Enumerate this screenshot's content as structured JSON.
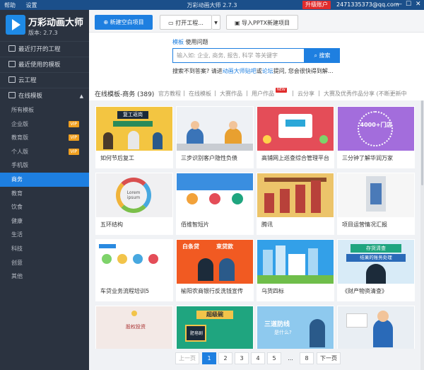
{
  "titlebar": {
    "help": "帮助",
    "settings": "设置",
    "title": "万彩动画大师 2.7.3",
    "upgrade": "升级账户",
    "account": "2471335373@qq.com",
    "min": "—",
    "max": "☐",
    "close": "✕"
  },
  "app": {
    "name": "万彩动画大师",
    "version": "版本: 2.7.3"
  },
  "sidebar": {
    "main": [
      {
        "label": "最近打开的工程"
      },
      {
        "label": "最近使用的模板"
      },
      {
        "label": "云工程"
      },
      {
        "label": "在线模板",
        "caret": "▲"
      }
    ],
    "sub": [
      {
        "label": "所有模板"
      },
      {
        "label": "企业版",
        "vip": "VIP"
      },
      {
        "label": "教育版",
        "vip": "VIP"
      },
      {
        "label": "个人版",
        "vip": "VIP"
      },
      {
        "label": "手机版"
      },
      {
        "label": "商务"
      },
      {
        "label": "教育"
      },
      {
        "label": "饮食"
      },
      {
        "label": "健康"
      },
      {
        "label": "生活"
      },
      {
        "label": "科技"
      },
      {
        "label": "创意"
      },
      {
        "label": "其他"
      }
    ]
  },
  "toolbar": {
    "new_project": "新建空白项目",
    "open_project": "打开工程...",
    "dropdown": "▼",
    "import_pptx": "导入PPTX新建项目"
  },
  "search": {
    "tab_template": "模板",
    "tab_help": "使用问题",
    "placeholder": "输入如: 企业, 商务, 报告, 科学 等关键字",
    "button": "搜索",
    "hint_prefix": "搜索不到答案? 请进",
    "hint_link1": "动画大师贴吧",
    "hint_or": "或",
    "hint_link2": "论坛",
    "hint_suffix": "提问, 您会很快得到解..."
  },
  "categories": {
    "current": "在线模板-商务 (389)",
    "tabs": [
      "官方教程",
      "在线模板",
      "大赛作品",
      "用户作品",
      "云分享",
      "大赛及优秀作品分享 (不断更新中"
    ],
    "new_badge": "NEW"
  },
  "templates": [
    "如何节后复工",
    "三步识别客户隐性负债",
    "高铺网上巡查综合管理平台",
    "三分钟了解华润万家",
    "五环结构",
    "佰维智短片",
    "腾讯",
    "项目运营情况汇报",
    "车贷业务流程培训5",
    "榆阳农商银行反洗钱宣传",
    "乌货四标",
    "《财产物资清查》",
    "",
    "",
    "",
    ""
  ],
  "thumb_text": {
    "t1": "复工返岗",
    "t4": "4000+门店",
    "t5": "Lorem ipsum",
    "t10": "白条贷",
    "t10b": "束贷款",
    "t12": "乌货四标",
    "t13": "股权投资",
    "t14": "超级碗",
    "t14b": "肥皂剧",
    "t15": "三道防线",
    "t15b": "是什么?",
    "t16": "存货清查",
    "t16b": "结果的账务处理"
  },
  "pager": {
    "prev": "上一页",
    "pages": [
      "1",
      "2",
      "3",
      "4",
      "5",
      "...",
      "8"
    ],
    "next": "下一页"
  },
  "colors": {
    "accent": "#1e7fe0",
    "sidebar": "#2b3340",
    "titlebar": "#1b4f8a"
  }
}
